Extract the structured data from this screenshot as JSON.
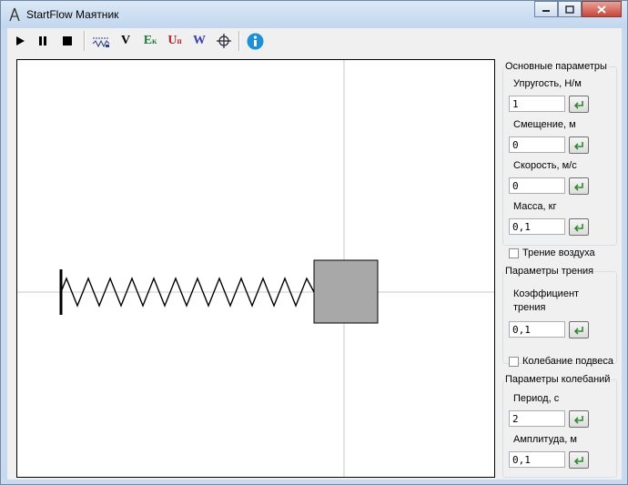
{
  "window": {
    "title": "StartFlow Маятник"
  },
  "toolbar": {
    "velocity_label": "V",
    "kinetic_label": "E",
    "kinetic_sub": "к",
    "potential_label": "U",
    "potential_sub": "п",
    "work_label": "W"
  },
  "panel": {
    "main_group_title": "Основные параметры",
    "elasticity_label": "Упругость, Н/м",
    "elasticity_value": "1",
    "displacement_label": "Смещение, м",
    "displacement_value": "0",
    "speed_label": "Скорость, м/с",
    "speed_value": "0",
    "mass_label": "Масса, кг",
    "mass_value": "0,1",
    "air_friction_label": "Трение воздуха",
    "air_friction_checked": false,
    "friction_group_title": "Параметры трения",
    "friction_coef_label_1": "Коэффициент",
    "friction_coef_label_2": "трения",
    "friction_coef_value": "0,1",
    "suspension_osc_label": "Колебание подвеса",
    "suspension_osc_checked": false,
    "osc_group_title": "Параметры колебаний",
    "period_label": "Период, с",
    "period_value": "2",
    "amplitude_label": "Амплитуда, м",
    "amplitude_value": "0,1"
  },
  "colors": {
    "velocity": "#000000",
    "kinetic": "#1e7a3a",
    "potential": "#b3262f",
    "work": "#3b3fb0",
    "info": "#1e90d8",
    "enter_arrow": "#2e8a2e",
    "block": "#a8a8a8"
  }
}
